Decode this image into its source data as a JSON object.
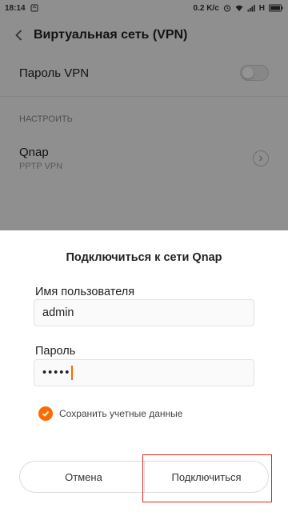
{
  "status_bar": {
    "time": "18:14",
    "speed": "0.2 K/c",
    "network": "H",
    "icons": [
      "notification-icon",
      "alarm-icon",
      "wifi-icon",
      "signal-icon",
      "battery-icon"
    ]
  },
  "header": {
    "title": "Виртуальная сеть (VPN)",
    "back_icon": "chevron-left-icon"
  },
  "settings": {
    "vpn_password_label": "Пароль VPN",
    "vpn_password_enabled": false,
    "section_header": "НАСТРОИТЬ",
    "vpn_entry": {
      "name": "Qnap",
      "type": "PPTP VPN",
      "detail_icon": "chevron-right-circle-icon"
    }
  },
  "dialog": {
    "title": "Подключиться к сети Qnap",
    "username_label": "Имя пользователя",
    "username_value": "admin",
    "password_label": "Пароль",
    "password_masked": "•••••",
    "save_credentials_label": "Сохранить учетные данные",
    "save_credentials_checked": true,
    "cancel_label": "Отмена",
    "connect_label": "Подключиться"
  },
  "colors": {
    "accent": "#ff6a00",
    "highlight_box": "#e0251b"
  }
}
